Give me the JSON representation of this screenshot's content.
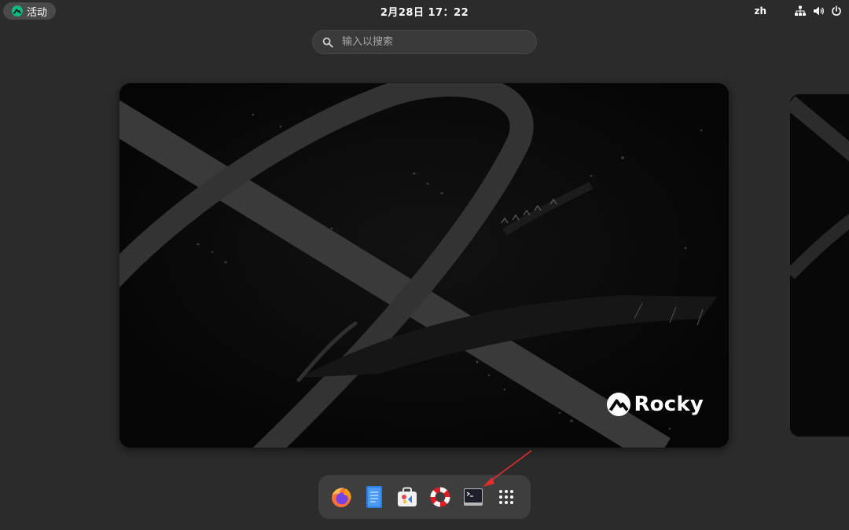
{
  "topbar": {
    "activities_label": "活动",
    "clock": "2月28日  17：22",
    "language": "zh",
    "tray_icons": [
      "network-icon",
      "volume-icon",
      "power-icon"
    ]
  },
  "search": {
    "placeholder": "输入以搜索"
  },
  "workspace": {
    "wallpaper_brand": "Rocky"
  },
  "dash": {
    "apps": [
      "firefox-icon",
      "text-editor-icon",
      "software-icon",
      "help-icon",
      "terminal-icon",
      "show-apps-icon"
    ]
  },
  "colors": {
    "accent": "#10b981",
    "annotation_arrow": "#e32d2d",
    "panel": "#3e3e3e",
    "background": "#2b2b2b"
  }
}
